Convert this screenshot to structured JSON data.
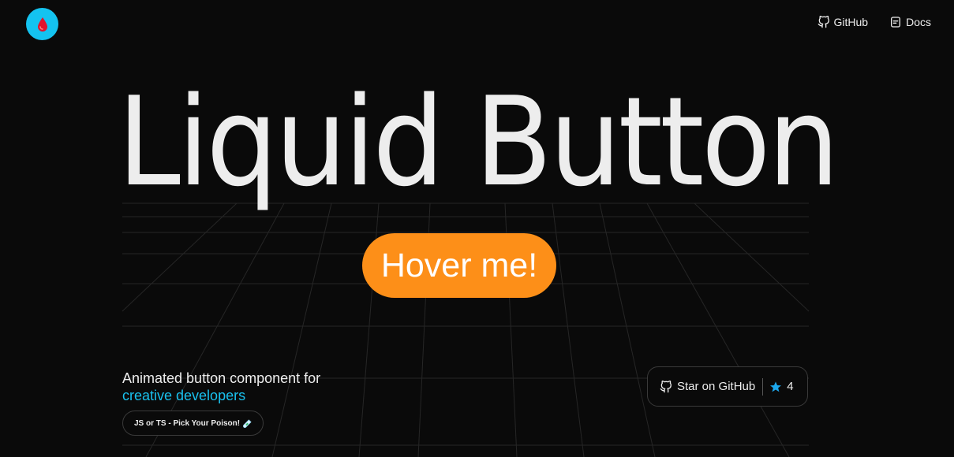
{
  "nav": {
    "github_label": "GitHub",
    "docs_label": "Docs"
  },
  "hero": {
    "title": "Liquid Button",
    "button_label": "Hover me!"
  },
  "tagline": {
    "line1": "Animated button component for",
    "line2": "creative developers"
  },
  "pill": {
    "label": "JS or TS - Pick Your Poison!"
  },
  "github_star": {
    "label": "Star on GitHub",
    "count": "4"
  },
  "colors": {
    "background": "#0a0a0a",
    "accent_cyan": "#19c1ee",
    "button_orange": "#fd8f18",
    "star_blue": "#1ca7ec"
  },
  "icons": [
    "droplet-icon",
    "github-icon",
    "docs-icon",
    "test-tube-icon",
    "star-icon"
  ]
}
